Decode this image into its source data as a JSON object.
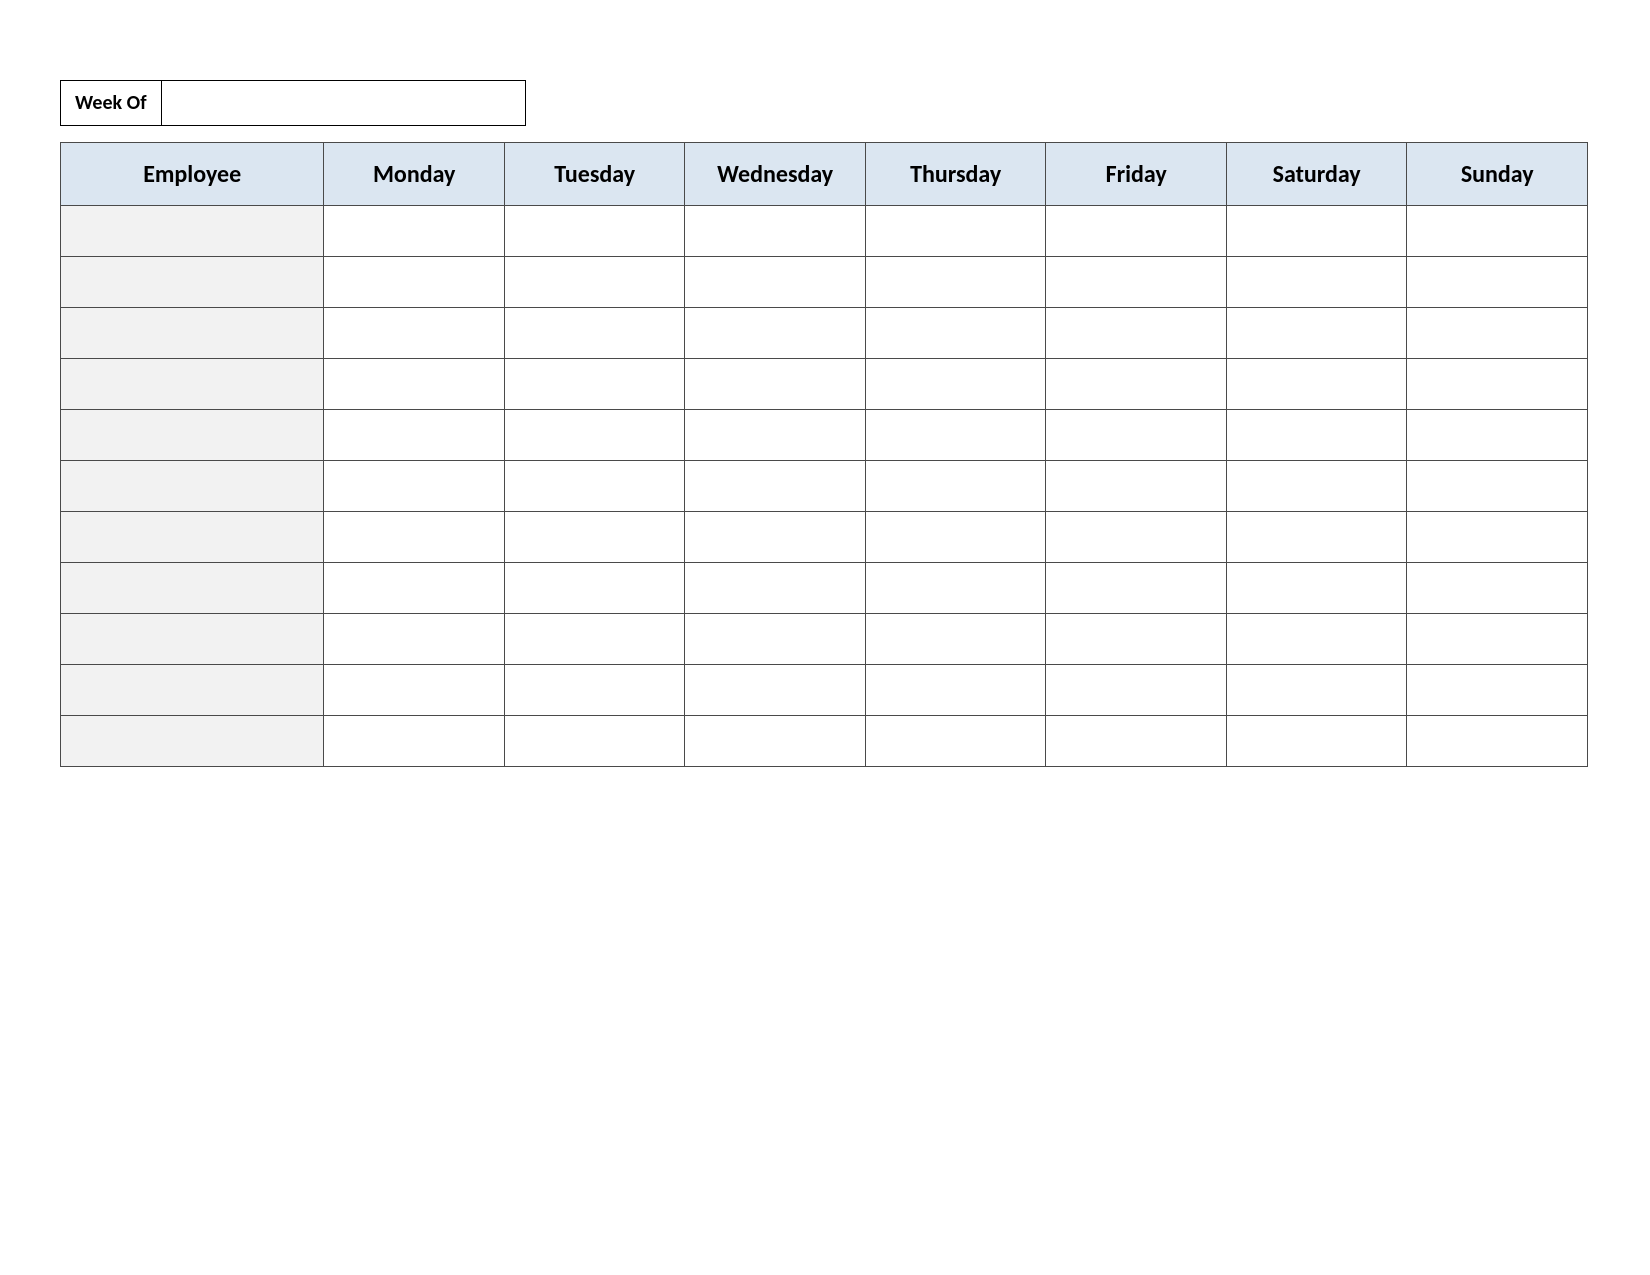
{
  "week_of_label": "Week Of",
  "week_of_value": "",
  "headers": {
    "employee": "Employee",
    "days": [
      "Monday",
      "Tuesday",
      "Wednesday",
      "Thursday",
      "Friday",
      "Saturday",
      "Sunday"
    ]
  },
  "rows": [
    {
      "employee": "",
      "days": [
        "",
        "",
        "",
        "",
        "",
        "",
        ""
      ]
    },
    {
      "employee": "",
      "days": [
        "",
        "",
        "",
        "",
        "",
        "",
        ""
      ]
    },
    {
      "employee": "",
      "days": [
        "",
        "",
        "",
        "",
        "",
        "",
        ""
      ]
    },
    {
      "employee": "",
      "days": [
        "",
        "",
        "",
        "",
        "",
        "",
        ""
      ]
    },
    {
      "employee": "",
      "days": [
        "",
        "",
        "",
        "",
        "",
        "",
        ""
      ]
    },
    {
      "employee": "",
      "days": [
        "",
        "",
        "",
        "",
        "",
        "",
        ""
      ]
    },
    {
      "employee": "",
      "days": [
        "",
        "",
        "",
        "",
        "",
        "",
        ""
      ]
    },
    {
      "employee": "",
      "days": [
        "",
        "",
        "",
        "",
        "",
        "",
        ""
      ]
    },
    {
      "employee": "",
      "days": [
        "",
        "",
        "",
        "",
        "",
        "",
        ""
      ]
    },
    {
      "employee": "",
      "days": [
        "",
        "",
        "",
        "",
        "",
        "",
        ""
      ]
    },
    {
      "employee": "",
      "days": [
        "",
        "",
        "",
        "",
        "",
        "",
        ""
      ]
    }
  ]
}
